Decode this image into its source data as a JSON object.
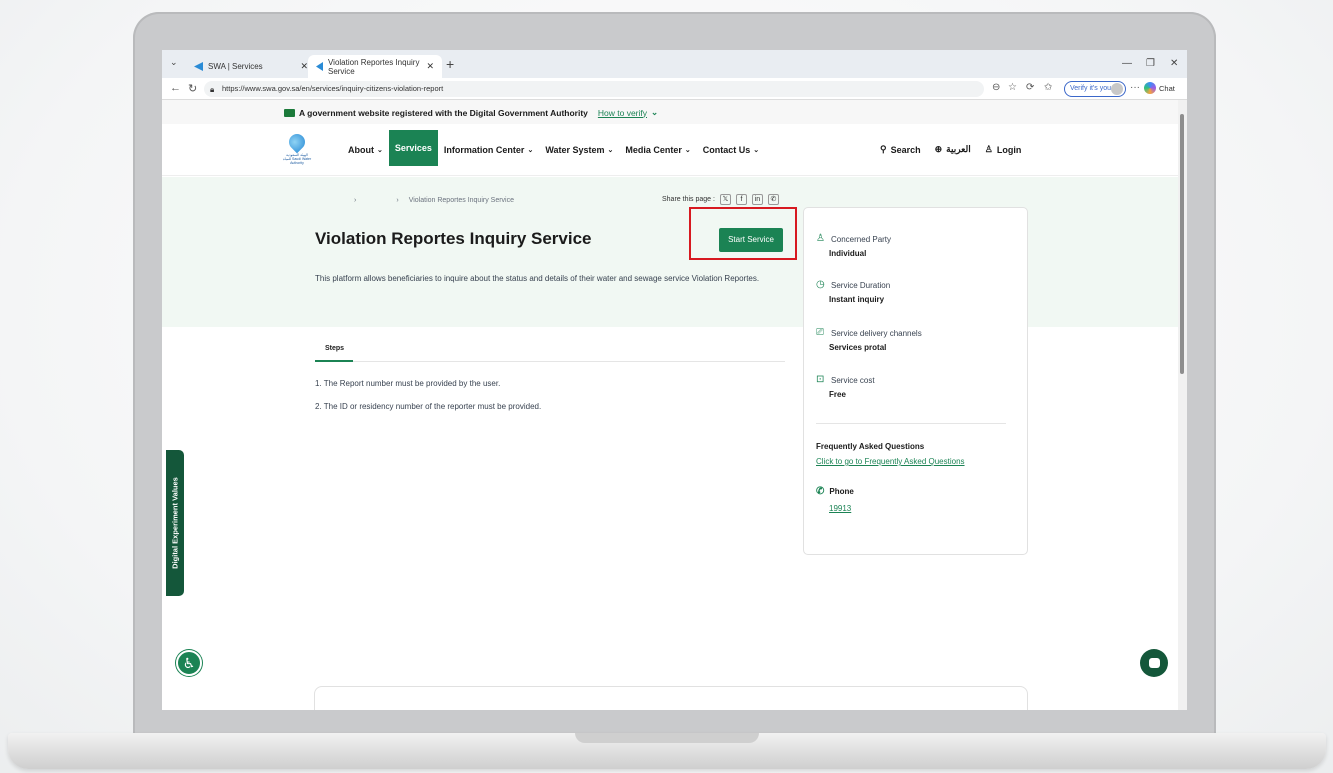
{
  "browser": {
    "tabs": [
      {
        "label": "SWA | Services"
      },
      {
        "label": "Violation Reportes Inquiry Service"
      }
    ],
    "url": "https://www.swa.gov.sa/en/services/inquiry-citizens-violation-report",
    "verify_label": "Verify it's you",
    "chat_label": "Chat"
  },
  "gov_bar": {
    "text": "A government website registered with the Digital Government Authority",
    "how_verify": "How to verify"
  },
  "header": {
    "logo_text": "الهيئة السعودية للمياه Saudi Water Authority",
    "nav": [
      {
        "label": "About"
      },
      {
        "label": "Services"
      },
      {
        "label": "Information Center"
      },
      {
        "label": "Water System"
      },
      {
        "label": "Media Center"
      },
      {
        "label": "Contact Us"
      }
    ],
    "search": "Search",
    "language": "العربية",
    "login": "Login"
  },
  "breadcrumb": {
    "current": "Violation Reportes Inquiry Service"
  },
  "share_label": "Share this page :",
  "service": {
    "title": "Violation Reportes Inquiry Service",
    "start_label": "Start Service",
    "description": "This platform allows beneficiaries to inquire about the status and details of their water and sewage service Violation Reportes."
  },
  "steps": {
    "tab_label": "Steps",
    "items": [
      "1. The Report number must be provided by the user.",
      "2. The ID or residency number of the reporter must be provided."
    ]
  },
  "details": {
    "concerned_party_label": "Concerned Party",
    "concerned_party_value": "Individual",
    "duration_label": "Service Duration",
    "duration_value": "Instant inquiry",
    "channels_label": "Service delivery channels",
    "channels_value": "Services protal",
    "cost_label": "Service cost",
    "cost_value": "Free",
    "faq_title": "Frequently Asked Questions",
    "faq_link": "Click to go to Frequently Asked Questions",
    "phone_label": "Phone",
    "phone_number": "19913"
  },
  "side_tab": "Digital Experiment Values",
  "colors": {
    "primary": "#1b8354",
    "dark_green": "#14573a",
    "hero_bg": "#f1f8f3",
    "highlight": "#d71920"
  }
}
